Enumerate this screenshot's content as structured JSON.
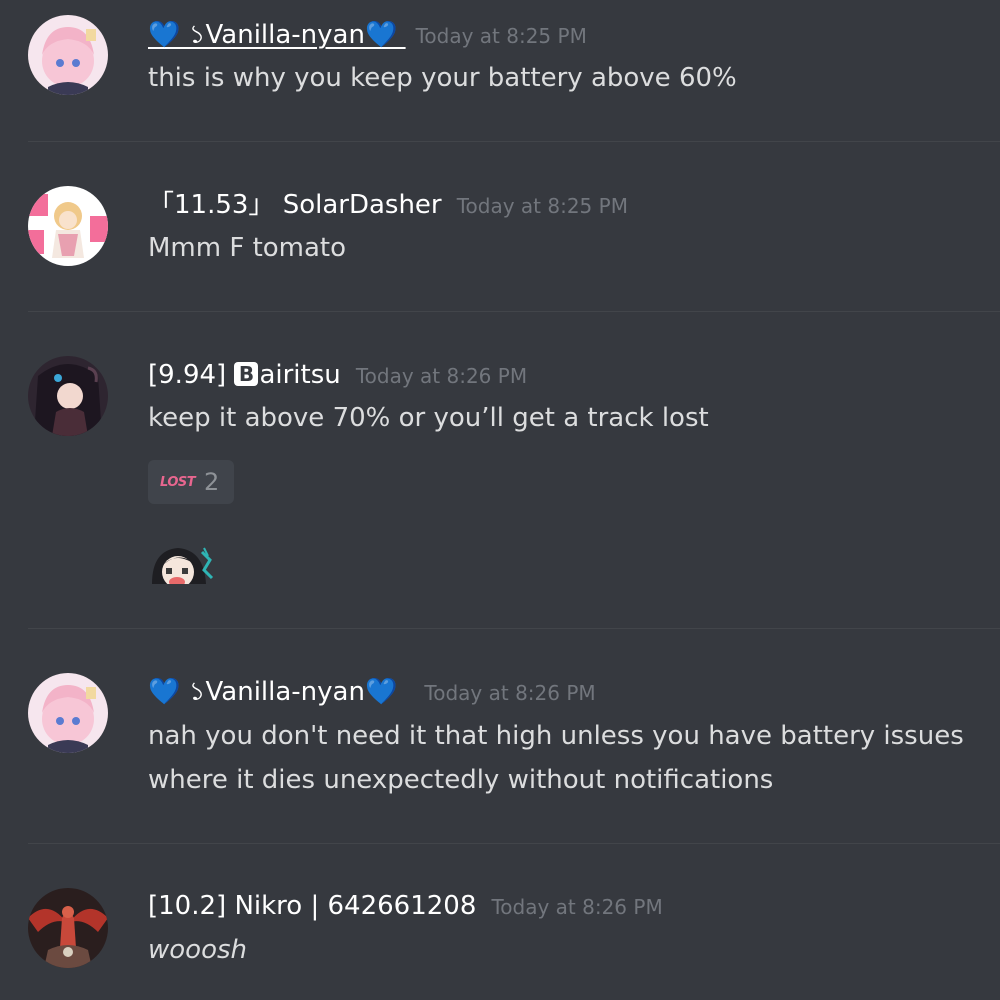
{
  "messages": [
    {
      "username": "💙 ১Vanilla-nyan💙 ",
      "timestamp": "Today at 8:25 PM",
      "content": "this is why you keep your battery above 60%"
    },
    {
      "username": "「11.53」 SolarDasher",
      "timestamp": "Today at 8:25 PM",
      "content": "Mmm F tomato"
    },
    {
      "username_prefix": "[9.94] ",
      "username_boxed_letter": "B",
      "username_rest": "airitsu",
      "timestamp": "Today at 8:26 PM",
      "content": "keep it above 70% or you’ll get a track lost",
      "reaction": {
        "emoji_text": "LOST",
        "count": "2"
      }
    },
    {
      "username": "💙 ১Vanilla-nyan💙",
      "timestamp": "Today at 8:26 PM",
      "content_line1": "nah you don't need it that high unless you have battery issues",
      "content_line2": "where it dies unexpectedly without notifications"
    },
    {
      "username": "[10.2] Nikro | 642661208",
      "timestamp": "Today at 8:26 PM",
      "content": "wooosh"
    }
  ],
  "colors": {
    "background": "#36393f",
    "username": "#ffffff",
    "timestamp": "#72767d",
    "text": "#dcddde",
    "heart": "#1e88ff",
    "reaction_bg": "#40444b"
  }
}
